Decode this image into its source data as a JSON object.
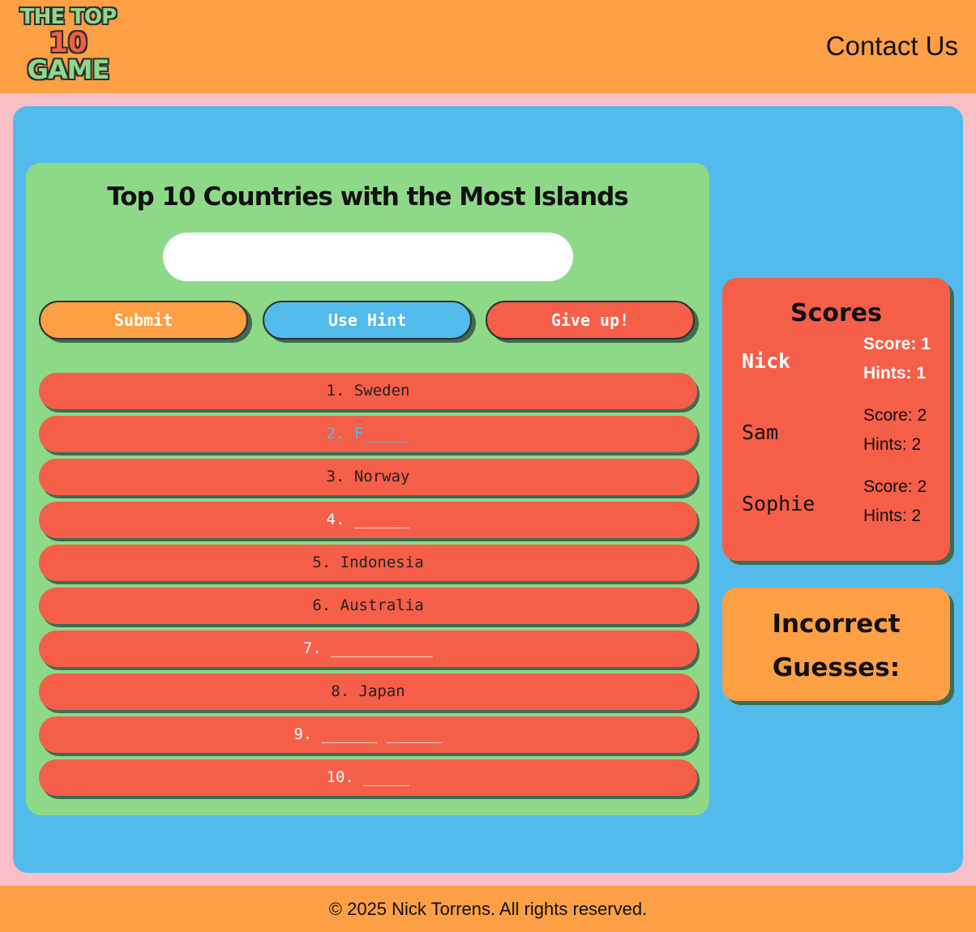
{
  "header": {
    "logo_line1": "THE TOP",
    "logo_line2": "10",
    "logo_line3": "GAME",
    "contact_label": "Contact Us"
  },
  "game": {
    "title": "Top 10 Countries with the Most Islands",
    "input_value": "",
    "buttons": {
      "submit": "Submit",
      "hint": "Use Hint",
      "give_up": "Give up!"
    },
    "answers": [
      {
        "text": "1. Sweden",
        "state": "revealed"
      },
      {
        "text": "2. F_____",
        "state": "hinted"
      },
      {
        "text": "3. Norway",
        "state": "revealed"
      },
      {
        "text": "4. ______",
        "state": "blank"
      },
      {
        "text": "5. Indonesia",
        "state": "revealed"
      },
      {
        "text": "6. Australia",
        "state": "revealed"
      },
      {
        "text": "7. ___________",
        "state": "blank"
      },
      {
        "text": "8. Japan",
        "state": "revealed"
      },
      {
        "text": "9. ______ ______",
        "state": "blank"
      },
      {
        "text": "10. _____",
        "state": "blank"
      }
    ]
  },
  "scores": {
    "title": "Scores",
    "players": [
      {
        "name": "Nick",
        "score": "Score: 1",
        "hints": "Hints: 1",
        "current": true
      },
      {
        "name": "Sam",
        "score": "Score: 2",
        "hints": "Hints: 2",
        "current": false
      },
      {
        "name": "Sophie",
        "score": "Score: 2",
        "hints": "Hints: 2",
        "current": false
      }
    ]
  },
  "incorrect": {
    "title": "Incorrect Guesses:"
  },
  "footer": {
    "text": "© 2025 Nick Torrens. All rights reserved."
  },
  "colors": {
    "orange": "#fd9f45",
    "blue": "#52bbec",
    "green": "#8ed988",
    "red": "#f55e48",
    "pink": "#fbbfc7"
  }
}
